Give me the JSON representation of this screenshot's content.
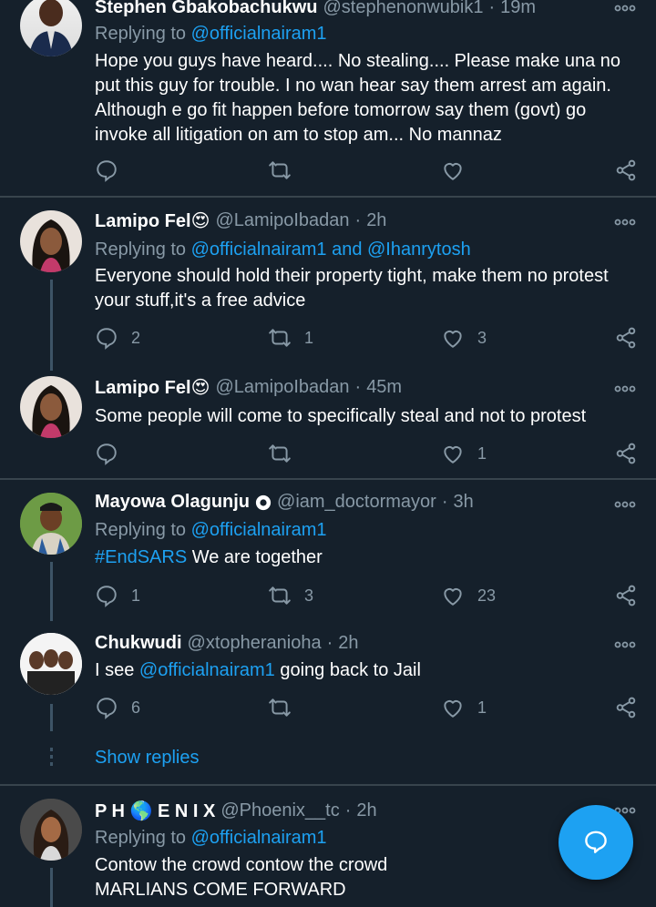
{
  "tweets": [
    {
      "name": "Stephen Gbakobachukwu",
      "handle": "@stephenonwubik1",
      "time": "19m",
      "replying_prefix": "Replying to",
      "replying_to": "@officialnairam1",
      "text": "Hope you guys have heard.... No stealing.... Please make una no put this guy for trouble. I no wan hear say them arrest am again. Although e go fit happen before tomorrow say them (govt) go invoke all litigation on am to stop am... No mannaz",
      "replies": "",
      "retweets": "",
      "likes": ""
    },
    {
      "name": "Lamipo Fel",
      "handle": "@LamipoIbadan",
      "time": "2h",
      "replying_prefix": "Replying to",
      "replying_to": "@officialnairam1 and @Ihanrytosh",
      "text": "Everyone should hold their property tight, make them no protest your stuff,it's a free advice",
      "replies": "2",
      "retweets": "1",
      "likes": "3"
    },
    {
      "name": "Lamipo Fel",
      "handle": "@LamipoIbadan",
      "time": "45m",
      "text": "Some people will come to specifically steal and not to protest",
      "replies": "",
      "retweets": "",
      "likes": "1"
    },
    {
      "name": "Mayowa Olagunju",
      "handle": "@iam_doctormayor",
      "time": "3h",
      "replying_prefix": "Replying to",
      "replying_to": "@officialnairam1",
      "hashtag": "#EndSARS",
      "text": " We are together",
      "replies": "1",
      "retweets": "3",
      "likes": "23"
    },
    {
      "name": "Chukwudi",
      "handle": "@xtopheranioha",
      "time": "2h",
      "text_before": "I see ",
      "mention": "@officialnairam1",
      "text_after": " going back to Jail",
      "replies": "6",
      "retweets": "",
      "likes": "1"
    },
    {
      "name": "P H 🌎 E N I X",
      "handle": "@Phoenix__tc",
      "time": "2h",
      "replying_prefix": "Replying to",
      "replying_to": "@officialnairam1",
      "text_line1": "Contow the crowd contow the crowd",
      "text_line2": "MARLIANS COME FORWARD"
    }
  ],
  "show_replies_label": "Show replies",
  "separator_dot": "·",
  "emoji_heart_eyes": "😍",
  "colors": {
    "background": "#15202b",
    "accent": "#1da1f2",
    "muted": "#8899a6",
    "divider": "#38444d"
  }
}
